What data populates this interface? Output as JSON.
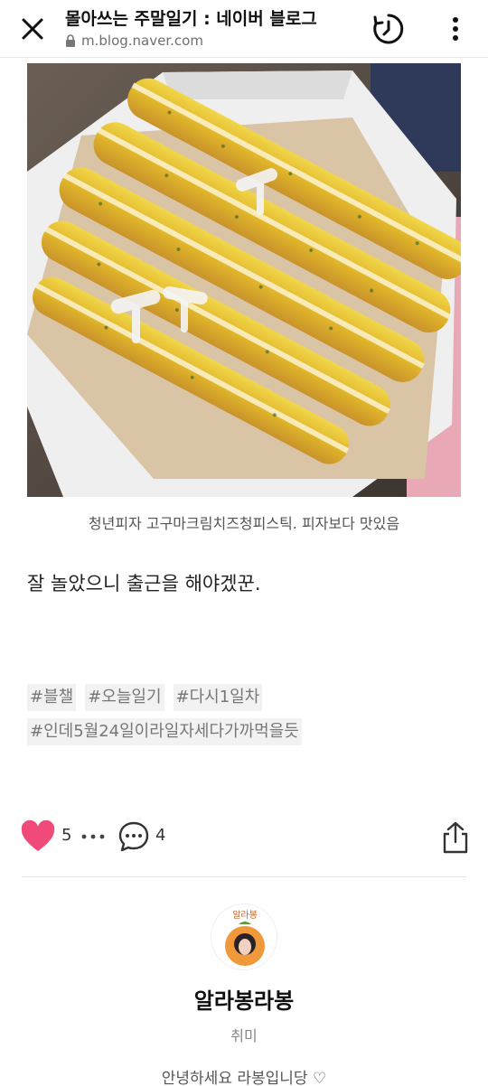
{
  "browser": {
    "title": "몰아쓰는 주말일기 : 네이버 블로그",
    "url": "m.blog.naver.com"
  },
  "post": {
    "caption": "청년피자 고구마크림치즈청피스틱. 피자보다 맛있음",
    "text": "잘 놀았으니 출근을 해야겠꾼.",
    "tags_line1": [
      "#블챌",
      "#오늘일기",
      "#다시1일차"
    ],
    "tags_line2": [
      "#인데5월24일이라일자세다가까먹을듯"
    ]
  },
  "actions": {
    "like_count": "5",
    "comment_count": "4"
  },
  "profile": {
    "avatar_text": "알라봉",
    "nickname": "알라봉라봉",
    "category": "취미",
    "intro": "안녕하세요 라봉입니당 ♡"
  },
  "colors": {
    "like": "#f04a7a",
    "tag_bg": "#f2f2f2"
  }
}
